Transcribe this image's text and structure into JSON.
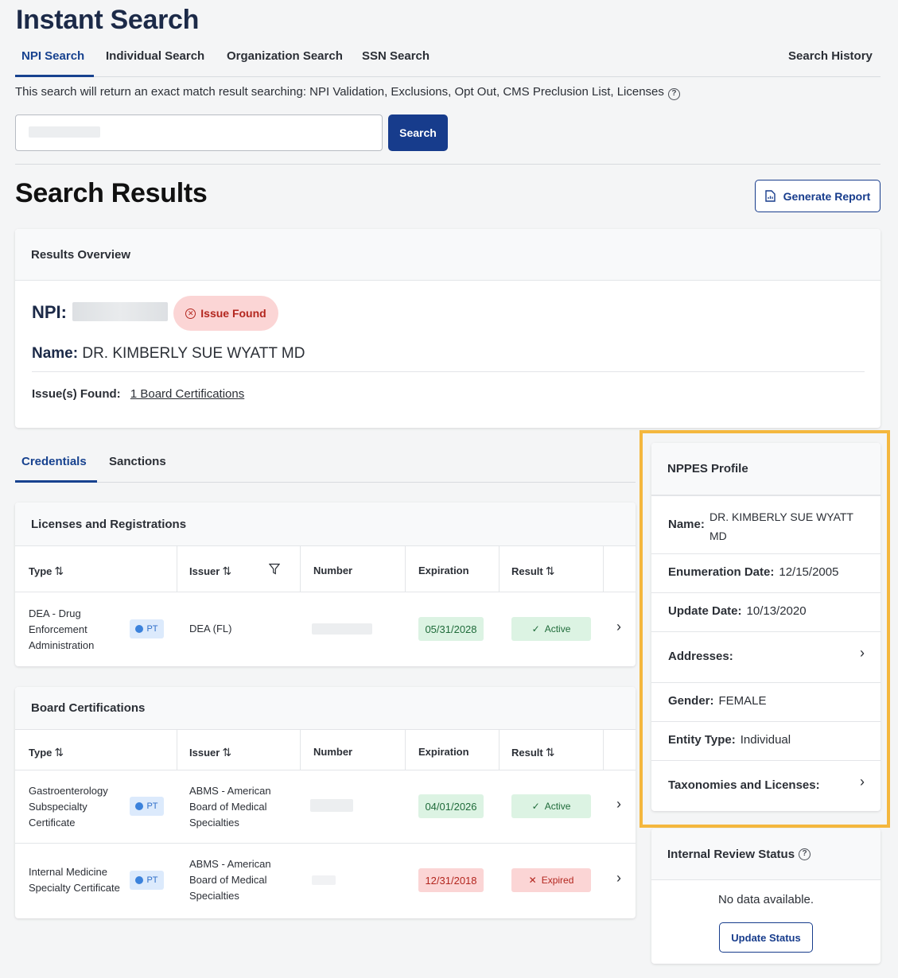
{
  "app": {
    "title": "Instant Search"
  },
  "top_tabs": [
    {
      "label": "NPI Search",
      "active": true
    },
    {
      "label": "Individual Search"
    },
    {
      "label": "Organization Search"
    },
    {
      "label": "SSN Search"
    },
    {
      "label": "Search History"
    }
  ],
  "search": {
    "info_text": "This search will return an exact match result searching: NPI Validation, Exclusions, Opt Out, CMS Preclusion List, Licenses",
    "button_label": "Search"
  },
  "results": {
    "title": "Search Results",
    "generate_report_label": "Generate Report",
    "overview": {
      "header": "Results Overview",
      "npi_label": "NPI:",
      "issue_badge": "Issue Found",
      "name_label": "Name:",
      "name_value": "DR. KIMBERLY SUE WYATT MD",
      "issues_label": "Issue(s) Found:",
      "issues_link": "1 Board Certifications"
    }
  },
  "detail_tabs": [
    {
      "label": "Credentials",
      "active": true
    },
    {
      "label": "Sanctions"
    }
  ],
  "licenses": {
    "header": "Licenses and Registrations",
    "columns": [
      "Type",
      "Issuer",
      "Number",
      "Expiration",
      "Result"
    ],
    "rows": [
      {
        "type_lines": [
          "DEA - Drug",
          "Enforcement",
          "Administration"
        ],
        "badge": "PT",
        "issuer": "DEA (FL)",
        "expiration": "05/31/2028",
        "result": "Active"
      }
    ]
  },
  "board": {
    "header": "Board Certifications",
    "columns": [
      "Type",
      "Issuer",
      "Number",
      "Expiration",
      "Result"
    ],
    "rows": [
      {
        "type_lines": [
          "Gastroenterology",
          "Subspecialty",
          "Certificate"
        ],
        "badge": "PT",
        "issuer_lines": [
          "ABMS - American",
          "Board of Medical",
          "Specialties"
        ],
        "expiration": "04/01/2026",
        "result": "Active"
      },
      {
        "type_lines": [
          "Internal Medicine",
          "Specialty Certificate"
        ],
        "badge": "PT",
        "issuer_lines": [
          "ABMS - American",
          "Board of Medical",
          "Specialties"
        ],
        "expiration": "12/31/2018",
        "result": "Expired"
      }
    ]
  },
  "nppes": {
    "header": "NPPES Profile",
    "name_label": "Name:",
    "name_lines": [
      "DR. KIMBERLY SUE WYATT",
      "MD"
    ],
    "enum_label": "Enumeration Date:",
    "enum_value": "12/15/2005",
    "update_label": "Update Date:",
    "update_value": "10/13/2020",
    "addresses_label": "Addresses:",
    "gender_label": "Gender:",
    "gender_value": "FEMALE",
    "entity_label": "Entity Type:",
    "entity_value": "Individual",
    "taxonomies_label": "Taxonomies and Licenses:"
  },
  "review": {
    "header": "Internal Review Status",
    "empty_text": "No data available.",
    "button_label": "Update Status"
  },
  "colors": {
    "brand": "#173c8c",
    "highlight": "#f4b73e",
    "active_green": "#dcf3e3",
    "expired_red": "#fbd5d5"
  }
}
